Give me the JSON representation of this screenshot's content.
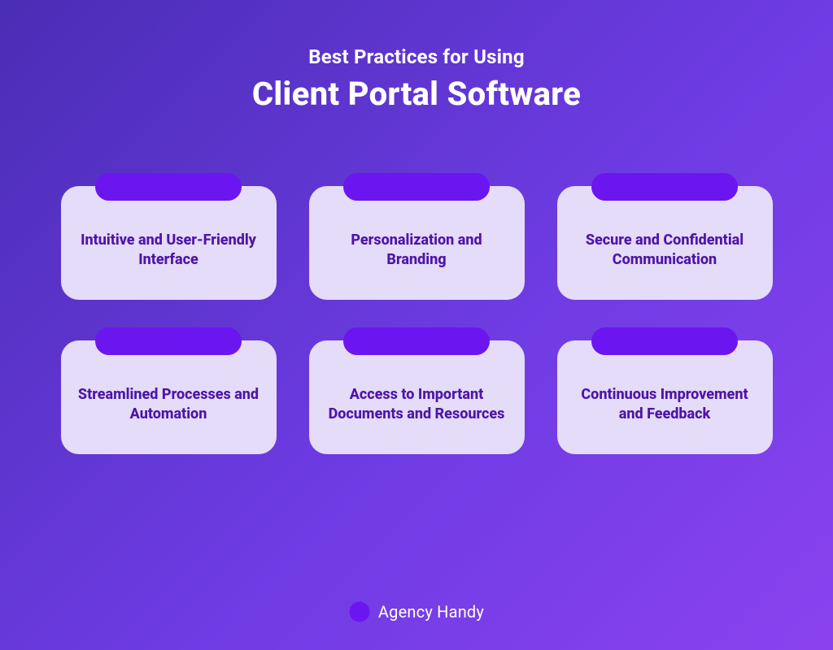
{
  "title": {
    "eyebrow": "Best Practices for Using",
    "headline": "Client Portal Software"
  },
  "tiles": [
    {
      "label": "Intuitive and User-Friendly Interface"
    },
    {
      "label": "Personalization and Branding"
    },
    {
      "label": "Secure and Confidential Communication"
    },
    {
      "label": "Streamlined Processes and Automation"
    },
    {
      "label": "Access to Important Documents and Resources"
    },
    {
      "label": "Continuous Improvement and Feedback"
    }
  ],
  "brand": {
    "name": "Agency Handy"
  },
  "colors": {
    "bg_gradient_start": "#4a2db5",
    "bg_gradient_end": "#8a42ef",
    "card_bg": "#e4dcf8",
    "card_text": "#4d15a8",
    "tab": "#6b16f0"
  }
}
